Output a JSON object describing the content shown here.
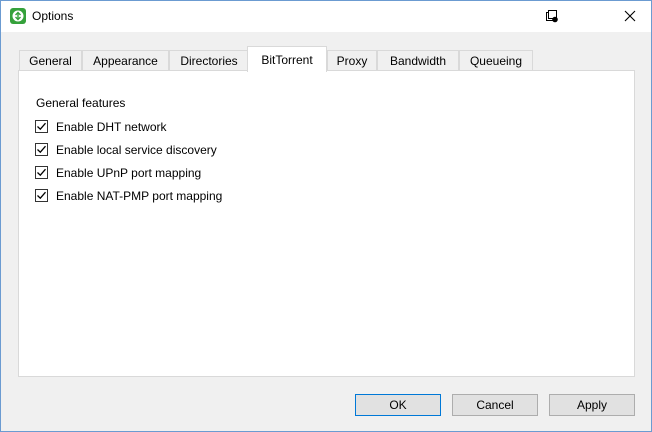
{
  "window": {
    "title": "Options",
    "accent_color": "#0078d7"
  },
  "titlebar": {
    "app_icon": "qbittorrent-app-icon",
    "help_icon": "context-help-icon",
    "close_icon": "close-icon"
  },
  "tabs": [
    {
      "label": "General",
      "active": false
    },
    {
      "label": "Appearance",
      "active": false
    },
    {
      "label": "Directories",
      "active": false
    },
    {
      "label": "BitTorrent",
      "active": true
    },
    {
      "label": "Proxy",
      "active": false
    },
    {
      "label": "Bandwidth",
      "active": false
    },
    {
      "label": "Queueing",
      "active": false
    }
  ],
  "bittorrent": {
    "group_label": "General features",
    "options": [
      {
        "label": "Enable DHT network",
        "checked": true
      },
      {
        "label": "Enable local service discovery",
        "checked": true
      },
      {
        "label": "Enable UPnP port mapping",
        "checked": true
      },
      {
        "label": "Enable NAT-PMP port mapping",
        "checked": true
      }
    ]
  },
  "buttons": {
    "ok": "OK",
    "cancel": "Cancel",
    "apply": "Apply"
  }
}
